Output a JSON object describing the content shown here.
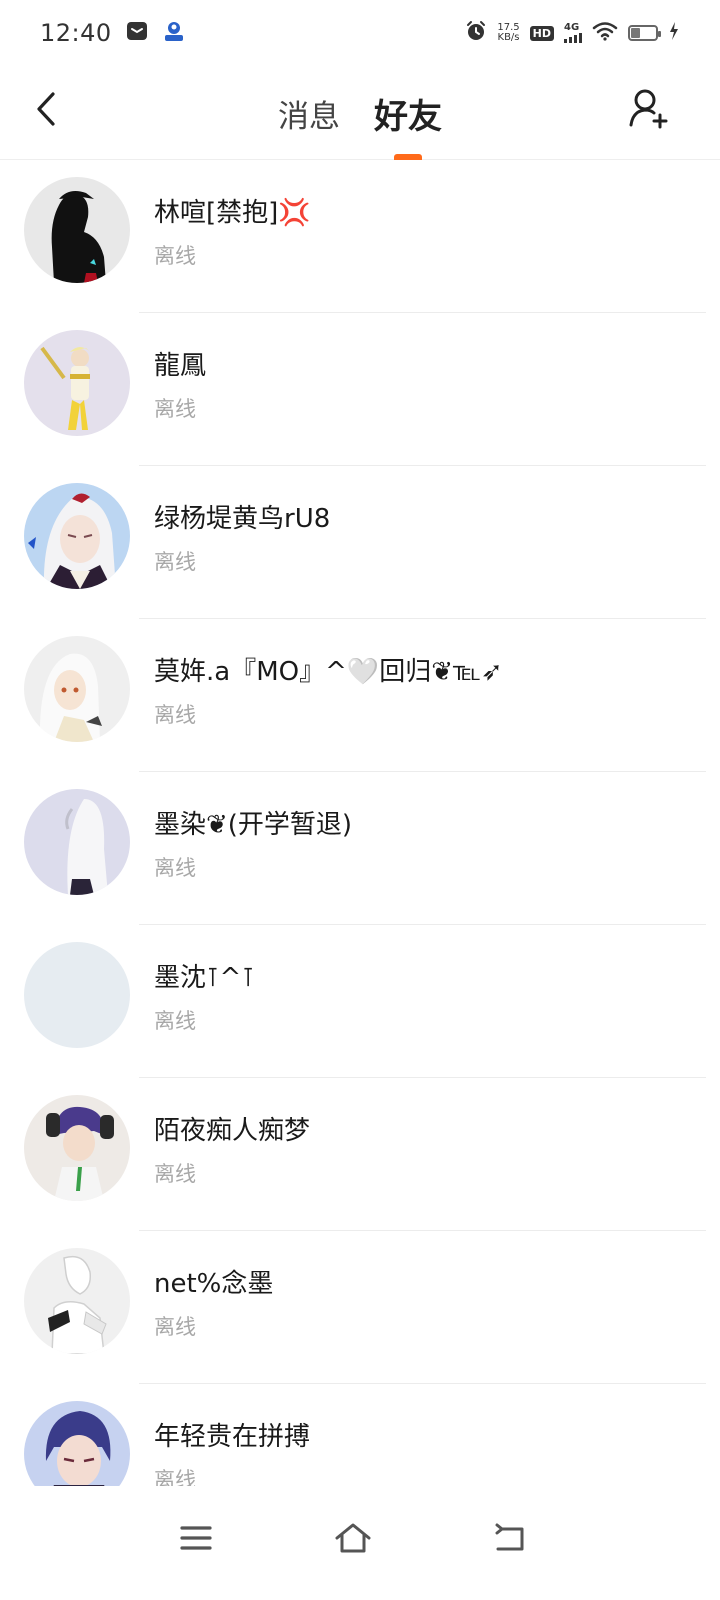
{
  "status_bar": {
    "time": "12:40",
    "net_speed_value": "17.5",
    "net_speed_unit": "KB/s",
    "hd_badge": "HD",
    "network_type": "4G",
    "battery_level": 0.35,
    "icons": [
      "message-icon",
      "app-notification-icon",
      "alarm-icon",
      "wifi-icon",
      "battery-icon",
      "charging-icon"
    ]
  },
  "header": {
    "tabs": [
      {
        "label": "消息",
        "active": false
      },
      {
        "label": "好友",
        "active": true
      }
    ],
    "accent_color": "#FF6A1A",
    "icons": [
      "back-arrow-icon",
      "add-friend-icon"
    ]
  },
  "friends": [
    {
      "name": "林喧[禁抱]💢",
      "status": "离线"
    },
    {
      "name": "龍鳳",
      "status": "离线"
    },
    {
      "name": "绿杨堤黄鸟rU8",
      "status": "离线"
    },
    {
      "name": "莫姩.a『MO』^🤍回归❦℡➶",
      "status": "离线"
    },
    {
      "name": "墨染❦(开学暂退)",
      "status": "离线"
    },
    {
      "name": "墨沈⊺^⊺",
      "status": "离线"
    },
    {
      "name": "陌夜痴人痴梦",
      "status": "离线"
    },
    {
      "name": "net%念墨",
      "status": "离线"
    },
    {
      "name": "年轻贵在拼搏",
      "status": "离线"
    }
  ],
  "nav_bar": {
    "icons": [
      "menu-icon",
      "home-icon",
      "back-icon"
    ]
  }
}
